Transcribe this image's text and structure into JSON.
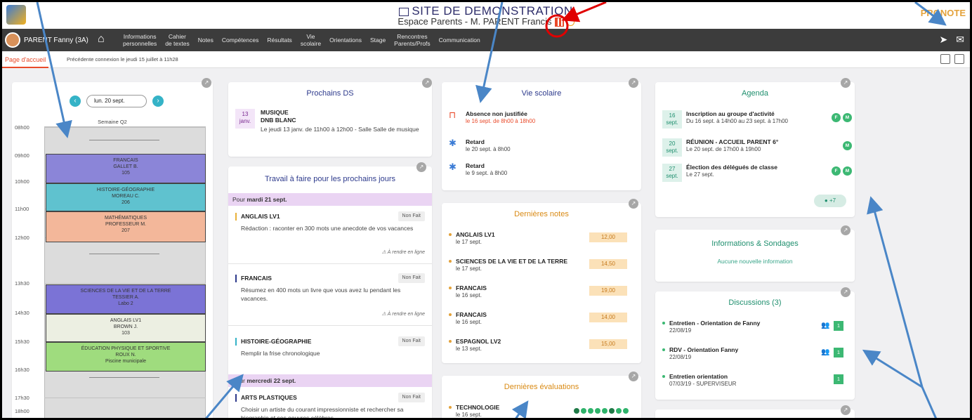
{
  "header": {
    "site_title": "SITE DE DEMONSTRATION",
    "space_label": "Espace Parents - M. PARENT Francis",
    "brand": "PRONOTE"
  },
  "navbar": {
    "user": "PARENT Fanny (3A)",
    "items": [
      "Informations\npersonnelles",
      "Cahier\nde textes",
      "Notes",
      "Compétences",
      "Résultats",
      "Vie\nscolaire",
      "Orientations",
      "Stage",
      "Rencontres\nParents/Profs",
      "Communication"
    ]
  },
  "subbar": {
    "tab": "Page d'accueil",
    "last_connection": "Précédente connexion le jeudi 15 juillet à 11h28"
  },
  "timetable": {
    "date": "lun. 20 sept.",
    "week": "Semaine Q2",
    "hours": [
      "08h00",
      "09h00",
      "10h00",
      "11h00",
      "12h00",
      "13h30",
      "14h30",
      "15h30",
      "16h30",
      "17h30",
      "18h00"
    ],
    "courses": [
      {
        "line1": "FRANCAIS",
        "line2": "GALLET B.",
        "line3": "105",
        "color": "#8b85d8"
      },
      {
        "line1": "HISTOIRE-GÉOGRAPHIE",
        "line2": "MOREAU C.",
        "line3": "206",
        "color": "#5fc2cf"
      },
      {
        "line1": "MATHÉMATIQUES",
        "line2": "PROFESSEUR M.",
        "line3": "207",
        "color": "#f3b79a"
      },
      {
        "line1": "SCIENCES DE LA VIE ET DE LA TERRE",
        "line2": "TESSIER A.",
        "line3": "Labo 2",
        "color": "#7b73d6"
      },
      {
        "line1": "ANGLAIS LV1",
        "line2": "BROWN J.",
        "line3": "103",
        "color": "#ecefe2"
      },
      {
        "line1": "ÉDUCATION PHYSIQUE ET SPORTIVE",
        "line2": "ROUX N.",
        "line3": "Piscine municipale",
        "color": "#9fdc7e"
      }
    ]
  },
  "ds": {
    "title": "Prochains DS",
    "day": "13",
    "month": "janv.",
    "subject": "MUSIQUE",
    "type": "DNB BLANC",
    "desc": "Le jeudi 13 janv. de 11h00 à 12h00 - Salle Salle de musique"
  },
  "homework": {
    "title": "Travail à faire pour les prochains jours",
    "day1": "mardi 21 sept.",
    "day2": "mercredi 22 sept.",
    "pour": "Pour",
    "status": "Non Fait",
    "online": "À rendre en ligne",
    "items": [
      {
        "subject": "ANGLAIS LV1",
        "text": "Rédaction : raconter en 300 mots une anecdote de vos vacances",
        "color": "#e9b13a"
      },
      {
        "subject": "FRANCAIS",
        "text": "Résumez en 400 mots un livre que vous avez lu pendant les vacances.",
        "color": "#2d3a8c"
      },
      {
        "subject": "HISTOIRE-GÉOGRAPHIE",
        "text": "Remplir la frise chronologique",
        "color": "#35b3c7"
      },
      {
        "subject": "ARTS PLASTIQUES",
        "text": "Choisir un artiste du courant impressionniste et rechercher sa biographie et ses oeuvres célèbres",
        "color": "#2d3a8c"
      }
    ]
  },
  "vie_scolaire": {
    "title": "Vie scolaire",
    "items": [
      {
        "title": "Absence non justifiée",
        "sub": "le 16 sept. de 8h00 à 18h00",
        "icon": "bed-icon",
        "sub_color": "#e94a2a"
      },
      {
        "title": "Retard",
        "sub": "le 20 sept. à 8h00",
        "icon": "runner-icon",
        "sub_color": "#444444"
      },
      {
        "title": "Retard",
        "sub": "le 9 sept. à 8h00",
        "icon": "runner-icon",
        "sub_color": "#444444"
      }
    ]
  },
  "notes": {
    "title": "Dernières notes",
    "items": [
      {
        "subject": "ANGLAIS LV1",
        "date": "le 17 sept.",
        "value": "12,00"
      },
      {
        "subject": "SCIENCES DE LA VIE ET DE LA TERRE",
        "date": "le 17 sept.",
        "value": "14,50"
      },
      {
        "subject": "FRANCAIS",
        "date": "le 16 sept.",
        "value": "19,00"
      },
      {
        "subject": "FRANCAIS",
        "date": "le 16 sept.",
        "value": "14,00"
      },
      {
        "subject": "ESPAGNOL LV2",
        "date": "le 13 sept.",
        "value": "15,00"
      }
    ]
  },
  "evaluations": {
    "title": "Dernières évaluations",
    "subject": "TECHNOLOGIE",
    "date": "le 16 sept."
  },
  "agenda": {
    "title": "Agenda",
    "more": "+7",
    "items": [
      {
        "day": "16",
        "month": "sept.",
        "title": "Inscription au groupe d'activité",
        "sub": "Du 16 sept. à 14h00 au 23 sept. à 17h00",
        "tags": [
          "F",
          "M"
        ]
      },
      {
        "day": "20",
        "month": "sept.",
        "title": "RÉUNION - ACCUEIL PARENT 6°",
        "sub": "Le 20 sept. de 17h00 à 19h00",
        "tags": [
          "M"
        ]
      },
      {
        "day": "27",
        "month": "sept.",
        "title": "Élection des délégués de classe",
        "sub": "Le 27 sept.",
        "tags": [
          "F",
          "M"
        ]
      }
    ]
  },
  "info": {
    "title": "Informations & Sondages",
    "empty": "Aucune nouvelle information"
  },
  "discussions": {
    "title": "Discussions (3)",
    "items": [
      {
        "title": "Entretien - Orientation de Fanny",
        "sub": "22/08/19",
        "count": "1",
        "people": true
      },
      {
        "title": "RDV - Orientation Fanny",
        "sub": "22/08/19",
        "count": "1",
        "people": true
      },
      {
        "title": "Entretien orientation",
        "sub": "07/03/19 - SUPERVISEUR",
        "count": "1",
        "people": false
      }
    ]
  }
}
